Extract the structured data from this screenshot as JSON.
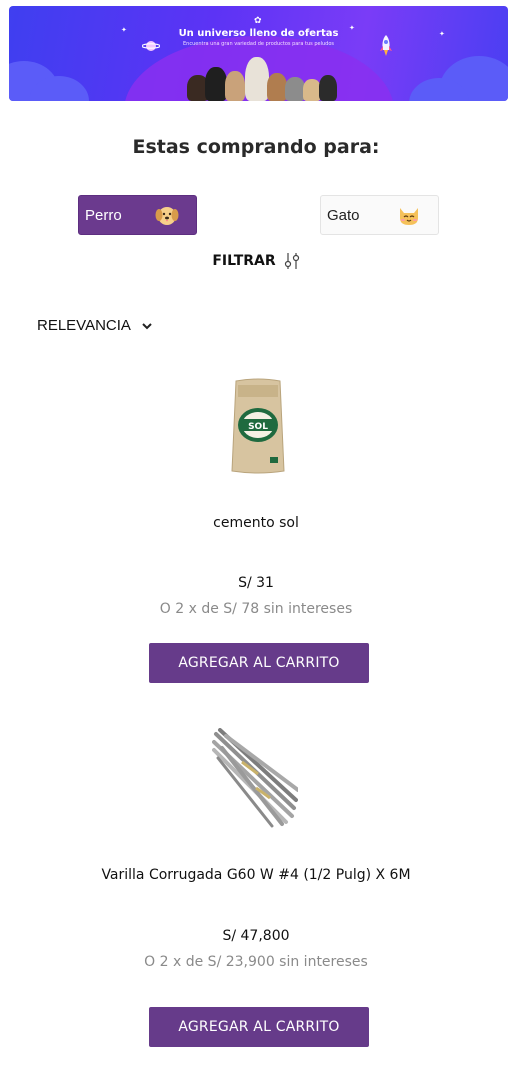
{
  "banner": {
    "title": "Un universo lleno de ofertas",
    "subtitle": "Encuentra una gran variedad de productos para tus peludos"
  },
  "selector": {
    "heading": "Estas comprando para:",
    "options": [
      {
        "label": "Perro",
        "icon": "dog-face-icon",
        "active": true
      },
      {
        "label": "Gato",
        "icon": "cat-face-icon",
        "active": false
      }
    ]
  },
  "filter": {
    "label": "FILTRAR",
    "icon": "sliders-icon"
  },
  "sort": {
    "label": "RELEVANCIA",
    "icon": "chevron-down-icon"
  },
  "products": [
    {
      "name": "cemento sol",
      "price": "S/ 31",
      "installments": "O 2 x de S/ 78 sin intereses",
      "button": "AGREGAR AL CARRITO",
      "image": "cement-bag-image",
      "bag_label": "SOL"
    },
    {
      "name": "Varilla Corrugada G60 W #4 (1/2 Pulg) X 6M",
      "price": "S/ 47,800",
      "installments": "O 2 x de S/ 23,900 sin intereses",
      "button": "AGREGAR AL CARRITO",
      "image": "steel-rebar-image"
    }
  ],
  "colors": {
    "primary": "#663b8a",
    "banner": "#5c33f5",
    "muted": "#8a8a8a"
  }
}
